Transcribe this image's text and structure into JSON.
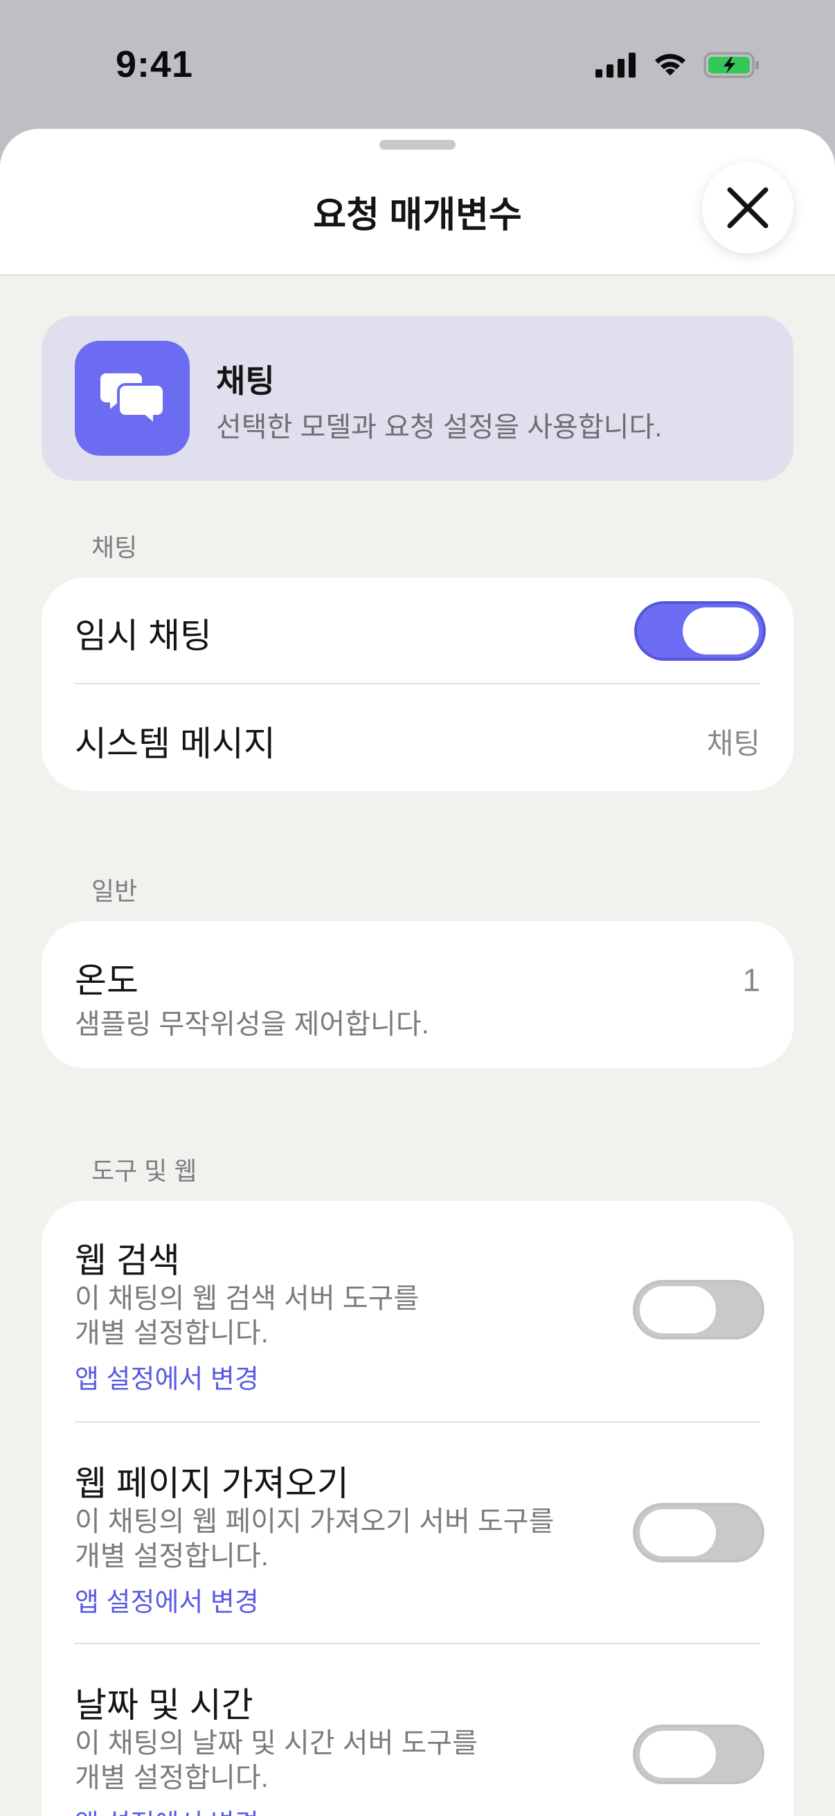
{
  "status_bar": {
    "time": "9:41",
    "signal_icon": "cellular-signal-icon",
    "wifi_icon": "wifi-icon",
    "battery_icon": "battery-charging-icon"
  },
  "sheet": {
    "title": "요청 매개변수",
    "close_icon": "close-icon"
  },
  "mode_card": {
    "title": "채팅",
    "description": "선택한 모델과 요청 설정을 사용합니다.",
    "icon": "chat-bubbles-icon",
    "accent": "#6B6CF2"
  },
  "sections": {
    "chat": {
      "label": "채팅",
      "temporary_chat": {
        "label": "임시 채팅",
        "enabled": true
      },
      "system_message": {
        "label": "시스템 메시지",
        "value": "채팅"
      }
    },
    "general": {
      "label": "일반",
      "temperature": {
        "label": "온도",
        "description": "샘플링 무작위성을 제어합니다.",
        "value": "1"
      }
    },
    "tools": {
      "label": "도구 및 웹",
      "items": [
        {
          "title": "웹 검색",
          "desc_line1": "이 채팅의 웹 검색 서버 도구를",
          "desc_line2": "개별 설정합니다.",
          "link": "앱 설정에서 변경",
          "enabled": false
        },
        {
          "title": "웹 페이지 가져오기",
          "desc_line1": "이 채팅의 웹 페이지 가져오기 서버 도구를",
          "desc_line2": "개별 설정합니다.",
          "link": "앱 설정에서 변경",
          "enabled": false
        },
        {
          "title": "날짜 및 시간",
          "desc_line1": "이 채팅의 날짜 및 시간 서버 도구를",
          "desc_line2": "개별 설정합니다.",
          "link": "앱 설정에서 변경",
          "enabled": false
        }
      ]
    }
  }
}
